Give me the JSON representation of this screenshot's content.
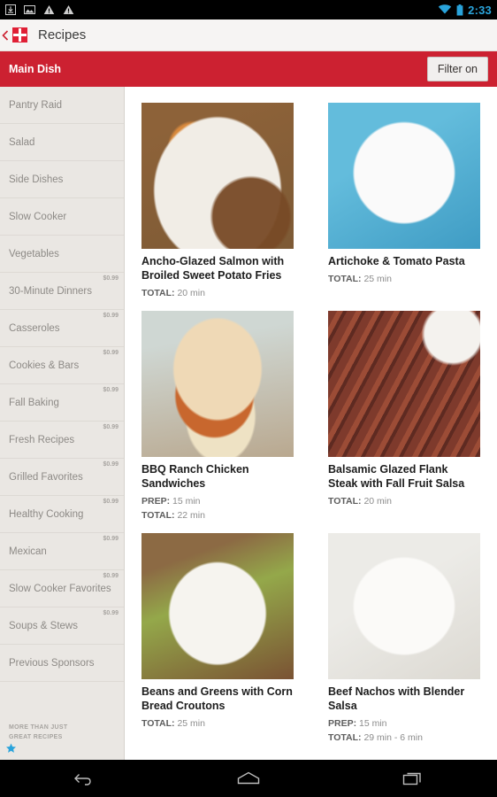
{
  "statusbar": {
    "time": "2:33",
    "left_icons": [
      "download-icon",
      "image-icon",
      "warning-icon",
      "warning-icon"
    ],
    "right_icons": [
      "wifi-icon",
      "battery-icon"
    ],
    "time_color": "#2aa5dd"
  },
  "appbar": {
    "title": "Recipes",
    "logo": "recipes-logo-icon",
    "up_icon": "back-arrow-icon"
  },
  "subbar": {
    "title": "Main Dish",
    "filter_label": "Filter on",
    "background": "#cc2131"
  },
  "sidebar": {
    "items": [
      {
        "label": "Pantry Raid",
        "price": ""
      },
      {
        "label": "Salad",
        "price": ""
      },
      {
        "label": "Side Dishes",
        "price": ""
      },
      {
        "label": "Slow Cooker",
        "price": ""
      },
      {
        "label": "Vegetables",
        "price": ""
      },
      {
        "label": "30-Minute Dinners",
        "price": "$0.99"
      },
      {
        "label": "Casseroles",
        "price": "$0.99"
      },
      {
        "label": "Cookies & Bars",
        "price": "$0.99"
      },
      {
        "label": "Fall Baking",
        "price": "$0.99"
      },
      {
        "label": "Fresh Recipes",
        "price": "$0.99"
      },
      {
        "label": "Grilled Favorites",
        "price": "$0.99"
      },
      {
        "label": "Healthy Cooking",
        "price": "$0.99"
      },
      {
        "label": "Mexican",
        "price": "$0.99"
      },
      {
        "label": "Slow Cooker Favorites",
        "price": "$0.99"
      },
      {
        "label": "Soups & Stews",
        "price": "$0.99"
      },
      {
        "label": "Previous Sponsors",
        "price": ""
      }
    ],
    "footer_line1": "MORE THAN JUST",
    "footer_line2": "GREAT RECIPES",
    "star_color": "#29a3db"
  },
  "recipes": [
    {
      "title": "Ancho-Glazed Salmon with Broiled Sweet Potato Fries",
      "prep_label": "",
      "prep": "",
      "total_label": "TOTAL:",
      "total": "20 min",
      "image": "salmon-sweet-potato-photo"
    },
    {
      "title": "Artichoke & Tomato Pasta",
      "prep_label": "",
      "prep": "",
      "total_label": "TOTAL:",
      "total": "25 min",
      "image": "artichoke-tomato-pasta-photo"
    },
    {
      "title": "BBQ Ranch Chicken Sandwiches",
      "prep_label": "PREP:",
      "prep": "15 min",
      "total_label": "TOTAL:",
      "total": "22 min",
      "image": "bbq-chicken-sandwich-photo"
    },
    {
      "title": "Balsamic Glazed Flank Steak with Fall Fruit Salsa",
      "prep_label": "",
      "prep": "",
      "total_label": "TOTAL:",
      "total": "20 min",
      "image": "flank-steak-photo"
    },
    {
      "title": "Beans and Greens with Corn Bread Croutons",
      "prep_label": "",
      "prep": "",
      "total_label": "TOTAL:",
      "total": "25 min",
      "image": "beans-greens-croutons-photo"
    },
    {
      "title": "Beef Nachos with Blender Salsa",
      "prep_label": "PREP:",
      "prep": "15 min",
      "total_label": "TOTAL:",
      "total": "29 min - 6 min",
      "image": "beef-nachos-photo"
    }
  ],
  "navbar": {
    "back": "back-icon",
    "home": "home-icon",
    "recents": "recents-icon"
  }
}
